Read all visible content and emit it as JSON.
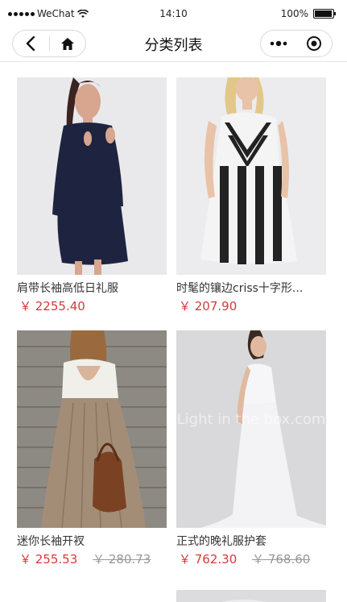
{
  "status_bar": {
    "carrier": "WeChat",
    "time": "14:10",
    "battery": "100%"
  },
  "nav": {
    "title": "分类列表",
    "icons": [
      "back-icon",
      "home-icon",
      "more-icon",
      "close-mini-program-icon"
    ]
  },
  "colors": {
    "price": "#d33a3a",
    "old_price": "#999999"
  },
  "products": [
    {
      "name": "肩带长袖高低日礼服",
      "price": "￥ 2255.40",
      "old_price": ""
    },
    {
      "name": "时髦的镶边criss十字形...",
      "price": "￥ 207.90",
      "old_price": ""
    },
    {
      "name": "迷你长袖开衩",
      "price": "￥ 255.53",
      "old_price": "￥ 280.73"
    },
    {
      "name": "正式的晚礼服护套",
      "price": "￥ 762.30",
      "old_price": "￥ 768.60"
    }
  ]
}
